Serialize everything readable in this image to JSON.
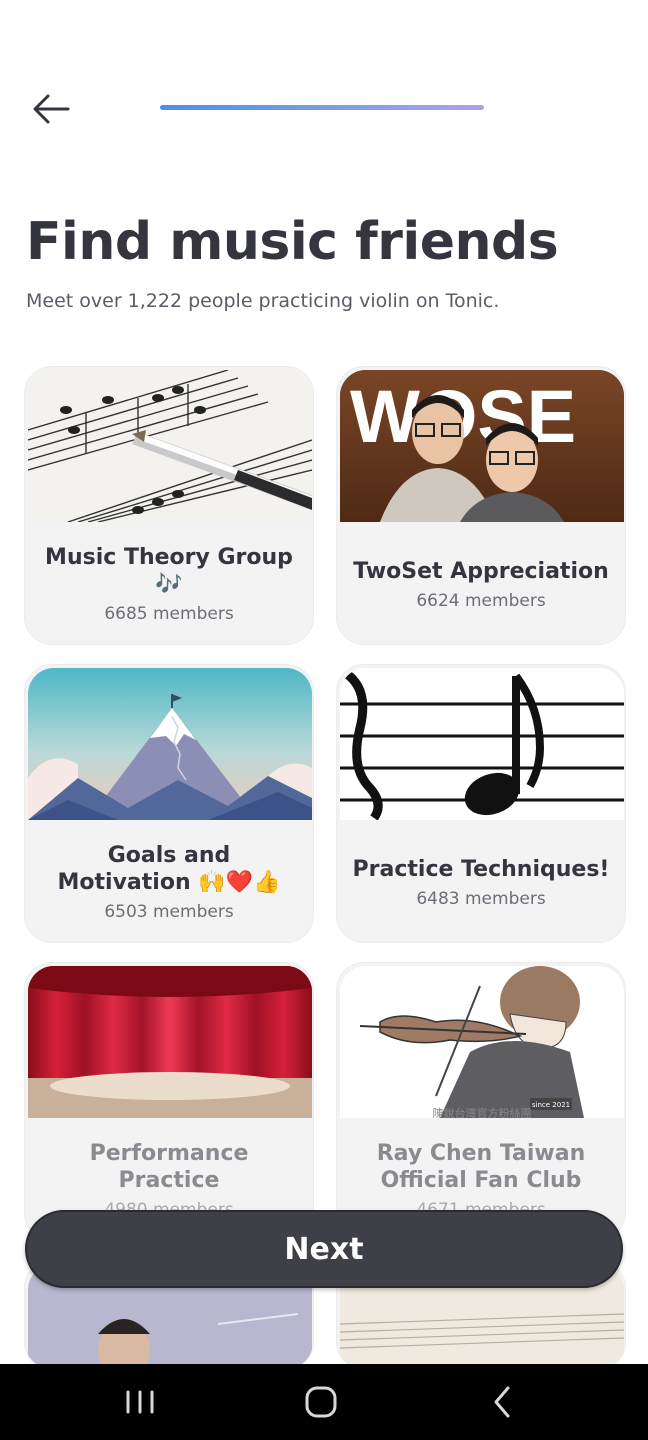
{
  "header": {
    "back_icon": "arrow-left-icon",
    "progress": 0.5
  },
  "page": {
    "title": "Find music friends",
    "subtitle": "Meet over 1,222 people practicing violin on Tonic."
  },
  "groups": [
    {
      "name": "Music Theory Group 🎶",
      "members": "6685 members",
      "image": "sheet-music-with-pen"
    },
    {
      "name": "TwoSet Appreciation",
      "members": "6624 members",
      "image": "twoset-violinists-poster",
      "image_text": "WOSE"
    },
    {
      "name": "Goals and Motivation 🙌❤️👍",
      "members": "6503 members",
      "image": "mountain-peak-flag"
    },
    {
      "name": "Practice Techniques!",
      "members": "6483 members",
      "image": "treble-clef-quarter-note"
    },
    {
      "name": "Performance Practice",
      "members": "4980 members",
      "image": "red-stage-curtain"
    },
    {
      "name": "Ray Chen Taiwan Official Fan Club",
      "members": "4671 members",
      "image": "violinist-illustration",
      "image_text": "陳銳台灣官方粉絲團",
      "image_badge": "since 2021"
    }
  ],
  "next_button": {
    "label": "Next"
  },
  "system_nav": {
    "recents_icon": "recents-icon",
    "home_icon": "home-icon",
    "back_icon": "chevron-left-icon"
  }
}
